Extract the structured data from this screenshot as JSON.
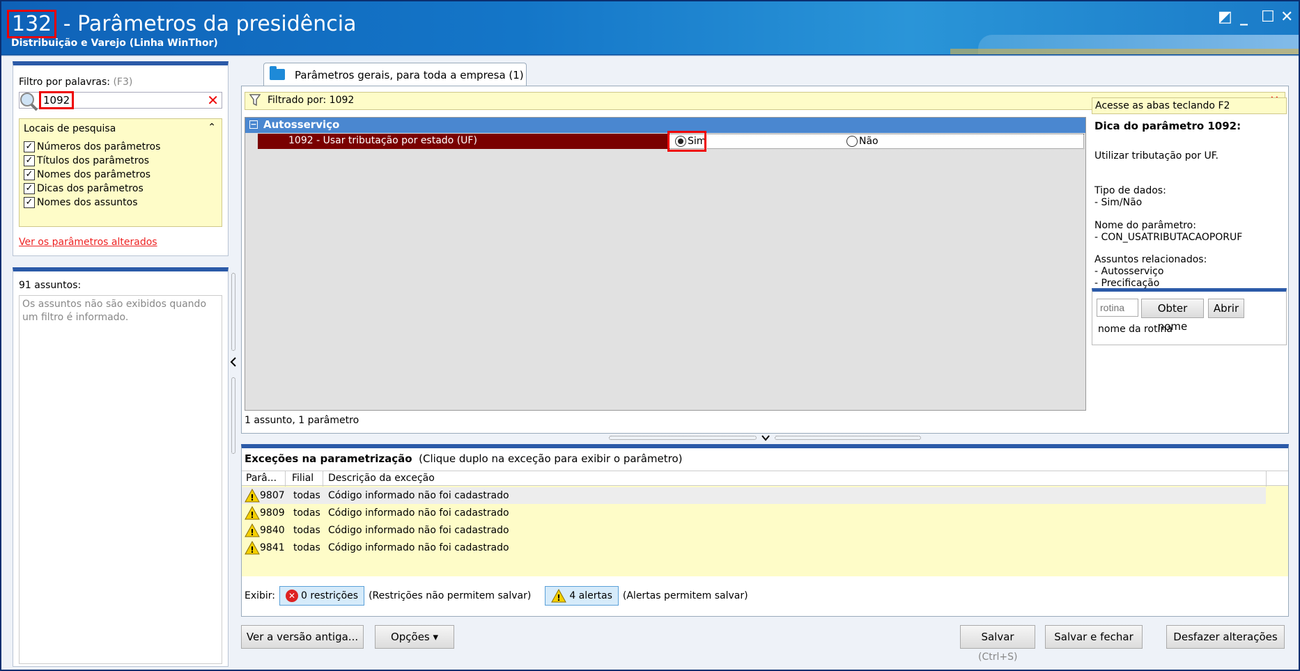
{
  "window": {
    "title_number": "132",
    "title_text": " - Parâmetros da presidência",
    "subtitle": "Distribuição e Varejo (Linha WinThor)",
    "controls": {
      "restore": "◩",
      "minimize": "_",
      "maximize": "☐",
      "close": "✕"
    }
  },
  "filter": {
    "label": "Filtro por palavras:",
    "shortcut": "(F3)",
    "value": "1092",
    "clear_icon": "✕",
    "locais_title": "Locais de pesquisa",
    "locais_collapse": "⌃",
    "checks": [
      "Números dos parâmetros",
      "Títulos dos parâmetros",
      "Nomes dos parâmetros",
      "Dicas dos parâmetros",
      "Nomes dos assuntos"
    ],
    "check_mark": "✓",
    "link_alterados": "Ver os parâmetros alterados"
  },
  "assuntos": {
    "label": "91 assuntos:",
    "message": "Os assuntos não são exibidos quando um filtro é informado."
  },
  "tab": {
    "label": "Parâmetros gerais, para toda a empresa  (1)"
  },
  "filter_bar": {
    "text": "Filtrado por: 1092",
    "close": "✕"
  },
  "grid": {
    "group": "Autosserviço",
    "group_toggle": "−",
    "param_name": "1092 - Usar tributação por estado (UF)",
    "option_yes": "Sim",
    "option_no": "Não",
    "selected": "Sim",
    "summary": "1 assunto, 1 parâmetro"
  },
  "side": {
    "hint": "Acesse as abas teclando F2",
    "title": "Dica do parâmetro 1092:",
    "description": "Utilizar tributação por UF.",
    "tipo_label": "Tipo de dados:",
    "tipo_value": " - Sim/Não",
    "nome_label": "Nome do parâmetro:",
    "nome_value": " - CON_USATRIBUTACAOPORUF",
    "assuntos_label": "Assuntos relacionados:",
    "assuntos_values": [
      " - Autosserviço",
      " - Precificação"
    ],
    "rotina_placeholder": "rotina",
    "obter_nome": "Obter nome",
    "abrir": "Abrir",
    "rotina_name": "nome da rotina"
  },
  "exceptions": {
    "title": "Exceções na parametrização",
    "note": "(Clique duplo na exceção para exibir o parâmetro)",
    "columns": [
      "Parâ...",
      "Filial",
      "Descrição da exceção"
    ],
    "rows": [
      {
        "param": "9807",
        "filial": "todas",
        "descricao": "Código informado não foi cadastrado"
      },
      {
        "param": "9809",
        "filial": "todas",
        "descricao": "Código informado não foi cadastrado"
      },
      {
        "param": "9840",
        "filial": "todas",
        "descricao": "Código informado não foi cadastrado"
      },
      {
        "param": "9841",
        "filial": "todas",
        "descricao": "Código informado não foi cadastrado"
      }
    ],
    "exibir": "Exibir:",
    "restricoes_btn": "0 restrições",
    "restricoes_note": "(Restrições não permitem salvar)",
    "alertas_btn": "4 alertas",
    "alertas_note": "(Alertas permitem salvar)"
  },
  "bottom": {
    "versao_antiga": "Ver a versão antiga...",
    "opcoes": "Opções ▾",
    "salvar": "Salvar",
    "salvar_shortcut": "(Ctrl+S)",
    "salvar_fechar": "Salvar e fechar",
    "desfazer": "Desfazer alterações"
  },
  "colors": {
    "title_bg": "#1476c8",
    "accent": "#2b5aa8",
    "highlight": "#e00000",
    "param_row": "#7a0000",
    "yellow_bg": "#fefcc8"
  }
}
